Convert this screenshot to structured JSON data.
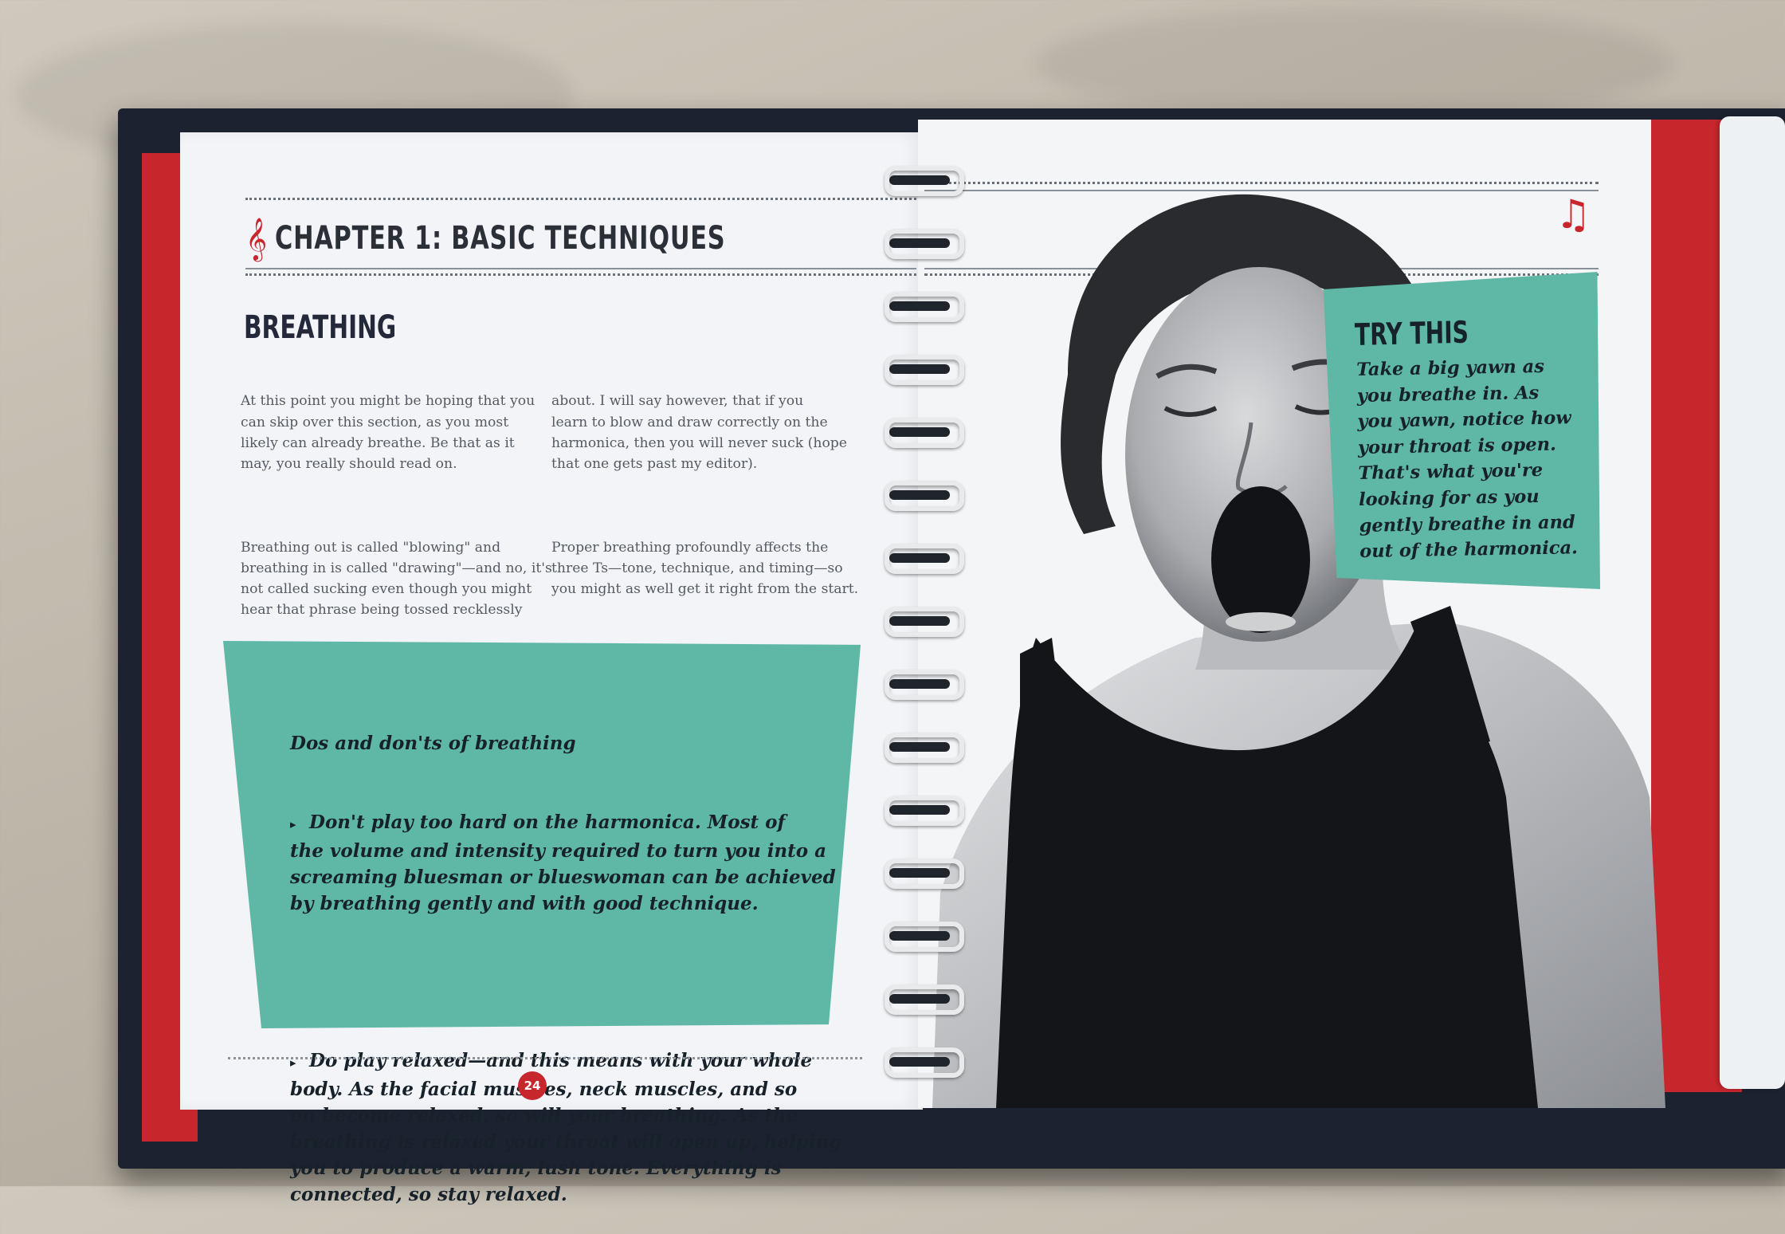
{
  "left_page": {
    "chapter_title": "CHAPTER 1: BASIC TECHNIQUES",
    "section_title": "BREATHING",
    "column_1": {
      "paragraph_1": "At this point you might be hoping that you\ncan skip over this section, as you most\nlikely can already breathe. Be that as it\nmay, you really should read on.",
      "paragraph_2": "Breathing out is called \"blowing\" and\nbreathing in is called \"drawing\"—and no, it's\nnot called sucking even though you might\nhear that phrase being tossed recklessly"
    },
    "column_2": {
      "paragraph_1": "about. I will say however, that if you\nlearn to blow and draw correctly on the\nharmonica, then you will never suck (hope\nthat one gets past my editor).",
      "paragraph_2": "Proper breathing profoundly affects the\nthree Ts—tone, technique, and timing—so\nyou might as well get it right from the start."
    },
    "dos_box": {
      "title": "Dos and don'ts of breathing",
      "item_1": "Don't play too hard on the harmonica. Most of\nthe volume and intensity required to turn you into a\nscreaming bluesman or blueswoman can be achieved\nby breathing gently and with good technique.",
      "item_2": "Do play relaxed—and this means with your whole\nbody. As the facial muscles, neck muscles, and so\non become relaxed, so will your breathing. As the\nbreathing is relaxed your throat will open up, helping\nyou to produce a warm, lush tone. Everything is\nconnected, so stay relaxed."
    },
    "page_number": "24"
  },
  "right_page": {
    "try_box": {
      "title": "TRY THIS",
      "text": "Take a big yawn as\nyou breathe in. As\nyou yawn, notice how\nyour throat is open.\nThat's what you're\nlooking for as you\ngently breathe in and\nout of the harmonica."
    }
  },
  "colors": {
    "accent_red": "#c8262d",
    "teal": "#5fb8a5",
    "book_cover": "#1d2230"
  },
  "icons": [
    "treble-clef-icon",
    "music-note-icon",
    "bullet-triangle-icon"
  ]
}
